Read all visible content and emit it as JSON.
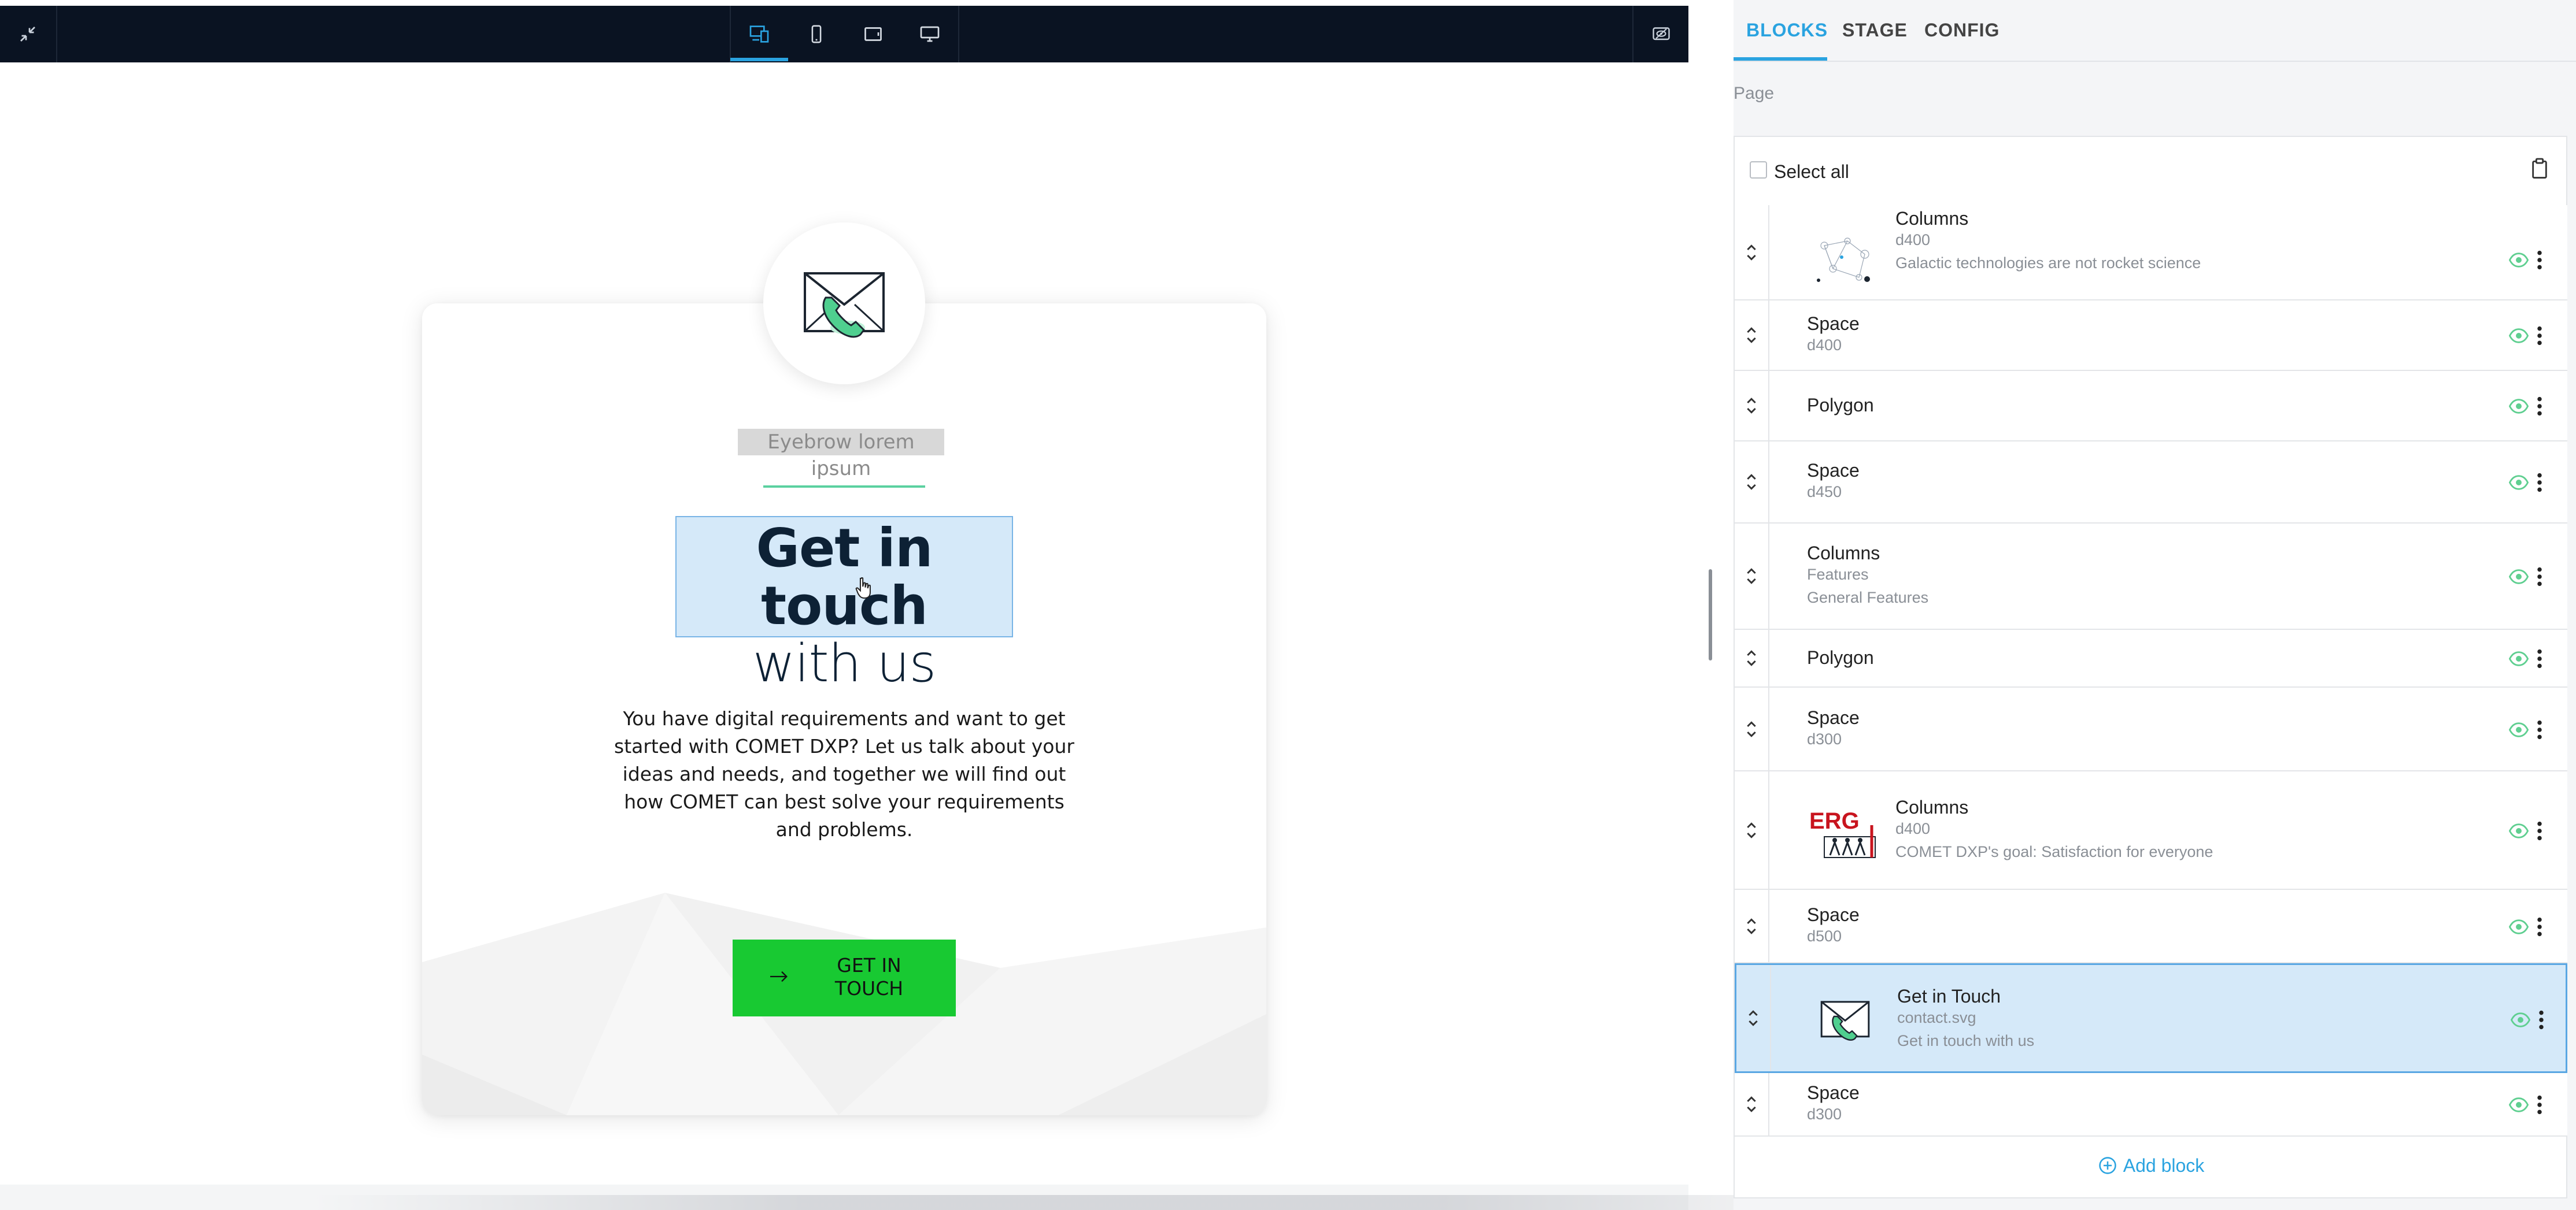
{
  "toolbar": {
    "buttons": [
      "collapse-icon",
      "responsive-icon",
      "mobile-icon",
      "tablet-icon",
      "desktop-icon",
      "preview-toggle-icon"
    ],
    "active": "responsive-icon",
    "accent": "#2aa3e0",
    "background": "#0a1322"
  },
  "preview": {
    "eyebrow": "Eyebrow lorem ipsum",
    "headline_line1": "Get in touch",
    "headline_line2": "with us",
    "body_lines": [
      "You have digital requirements and want to get",
      "started with COMET DXP? Let us talk about your",
      "ideas and needs, and together we will find out",
      "how COMET can best solve your requirements",
      "and problems."
    ],
    "cta_line1": "GET IN",
    "cta_line2": "TOUCH",
    "cta_color": "#18c932",
    "icon": "phone-envelope-icon"
  },
  "panel": {
    "tabs": [
      "BLOCKS",
      "STAGE",
      "CONFIG"
    ],
    "active_tab": "BLOCKS",
    "page_label": "Page",
    "select_all": "Select all",
    "add_block": "Add block",
    "blocks": [
      {
        "title": "Columns",
        "sub1": "d400",
        "sub2": "Galactic technologies are not rocket science",
        "thumb": "diagram-thumbnail",
        "visible": true
      },
      {
        "title": "Space",
        "sub1": "d400",
        "visible": true
      },
      {
        "title": "Polygon",
        "visible": true
      },
      {
        "title": "Space",
        "sub1": "d450",
        "visible": true
      },
      {
        "title": "Columns",
        "sub1": "Features",
        "sub2": "General Features",
        "visible": true
      },
      {
        "title": "Polygon",
        "visible": true
      },
      {
        "title": "Space",
        "sub1": "d300",
        "visible": true
      },
      {
        "title": "Columns",
        "sub1": "d400",
        "sub2": "COMET DXP's goal: Satisfaction for everyone",
        "thumb": "erg-logo-thumbnail",
        "visible": true
      },
      {
        "title": "Space",
        "sub1": "d500",
        "visible": true
      },
      {
        "title": "Get in Touch",
        "sub1": "contact.svg",
        "sub2": "Get in touch with us",
        "thumb": "phone-envelope-thumbnail",
        "visible": true,
        "selected": true
      },
      {
        "title": "Space",
        "sub1": "d300",
        "visible": true
      }
    ]
  }
}
